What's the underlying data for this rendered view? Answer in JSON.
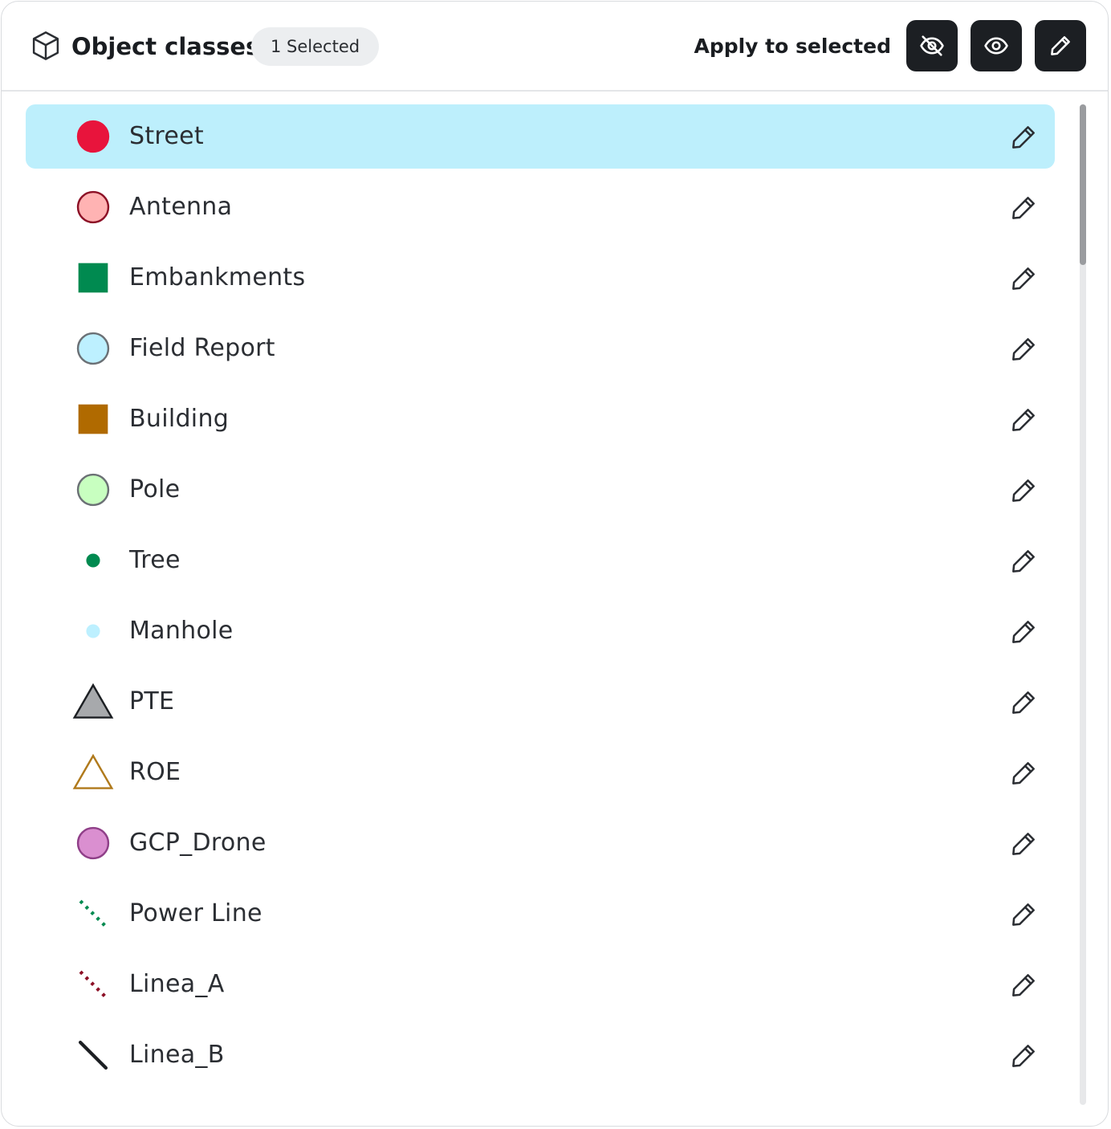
{
  "header": {
    "title": "Object classes",
    "badge": "1 Selected",
    "apply_label": "Apply to selected",
    "buttons": [
      {
        "icon": "eye-off-icon"
      },
      {
        "icon": "eye-icon"
      },
      {
        "icon": "pencil-icon"
      }
    ]
  },
  "items": [
    {
      "label": "Street",
      "symbol": "circle",
      "fill": "#e8143c",
      "stroke": "#e8143c",
      "selected": true
    },
    {
      "label": "Antenna",
      "symbol": "circle",
      "fill": "#ffb3b3",
      "stroke": "#8c1026",
      "selected": false
    },
    {
      "label": "Embankments",
      "symbol": "square",
      "fill": "#008a50",
      "stroke": "#008a50",
      "selected": false
    },
    {
      "label": "Field Report",
      "symbol": "circle",
      "fill": "#bdf0ff",
      "stroke": "#6b7075",
      "selected": false
    },
    {
      "label": "Building",
      "symbol": "square",
      "fill": "#b06a00",
      "stroke": "#b06a00",
      "selected": false
    },
    {
      "label": "Pole",
      "symbol": "circle",
      "fill": "#c8ffc0",
      "stroke": "#6b7075",
      "selected": false
    },
    {
      "label": "Tree",
      "symbol": "dot",
      "fill": "#008a50",
      "stroke": "#008a50",
      "selected": false
    },
    {
      "label": "Manhole",
      "symbol": "dot",
      "fill": "#bdf0ff",
      "stroke": "#bdf0ff",
      "selected": false
    },
    {
      "label": "PTE",
      "symbol": "triangle",
      "fill": "#a7a9ac",
      "stroke": "#1c1f23",
      "selected": false
    },
    {
      "label": "ROE",
      "symbol": "triangle",
      "fill": "#ffffff",
      "stroke": "#b07a1c",
      "selected": false
    },
    {
      "label": "GCP_Drone",
      "symbol": "circle",
      "fill": "#da8fd0",
      "stroke": "#8f3f88",
      "selected": false
    },
    {
      "label": "Power Line",
      "symbol": "dotted-line",
      "fill": "#008a50",
      "stroke": "#008a50",
      "selected": false
    },
    {
      "label": "Linea_A",
      "symbol": "dotted-line",
      "fill": "#8c1026",
      "stroke": "#8c1026",
      "selected": false
    },
    {
      "label": "Linea_B",
      "symbol": "line",
      "fill": "#1c1f23",
      "stroke": "#1c1f23",
      "selected": false
    }
  ]
}
